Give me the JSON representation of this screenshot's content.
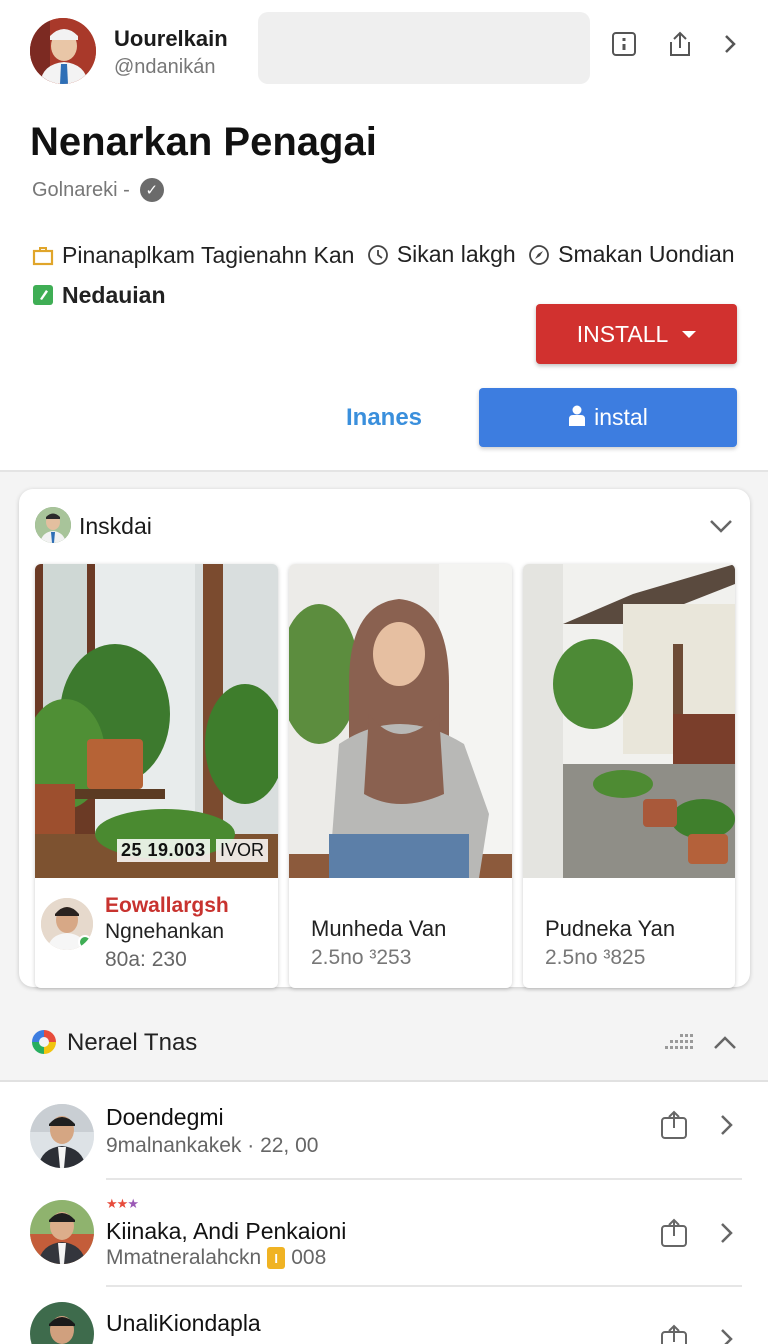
{
  "header": {
    "user_name": "Uourelkain",
    "user_handle": "@ndanikán",
    "icons": [
      "info-box-icon",
      "share-icon",
      "chevron-right-icon"
    ]
  },
  "app": {
    "title": "Nenarkan Penagai",
    "developer": "Golnareki -",
    "meta_items": [
      {
        "icon": "briefcase-icon",
        "label": "Pinanaplkam Tagienahn Kan"
      },
      {
        "icon": "clock-icon",
        "label": "Sikan lakgh"
      },
      {
        "icon": "compass-icon",
        "label": "Smakan Uondian"
      },
      {
        "icon": "edit-icon",
        "label": "Nedauian"
      }
    ],
    "install_button": "INSTALL",
    "secondary_link": "Inanes",
    "instal_button": "instal"
  },
  "card": {
    "title": "Inskdai",
    "tiles": [
      {
        "price": "25 19.003",
        "price_tag": "IVOR",
        "reviewer_title": "Eowallargsh",
        "reviewer_name": "Ngnehankan",
        "reviewer_stat": "80a: 230"
      },
      {
        "name": "Munheda Van",
        "sub": "2.5no ³253"
      },
      {
        "name": "Pudneka Yan",
        "sub": "2.5no ³825"
      }
    ]
  },
  "section2": {
    "title": "Nerael Tnas",
    "rows": [
      {
        "title": "Doendegmi",
        "sub": "9malnankakek · 22, 00"
      },
      {
        "title": "Kiinaka, Andi Penkaioni",
        "sub": "Mmatneralahckn",
        "badge": "I",
        "count": "008"
      },
      {
        "title": "UnaliKiondapla",
        "sub": ""
      }
    ]
  },
  "colors": {
    "install_red": "#d1312f",
    "instal_blue": "#3d7de0",
    "link_blue": "#3a8fdc",
    "accent_red": "#c8332f"
  }
}
